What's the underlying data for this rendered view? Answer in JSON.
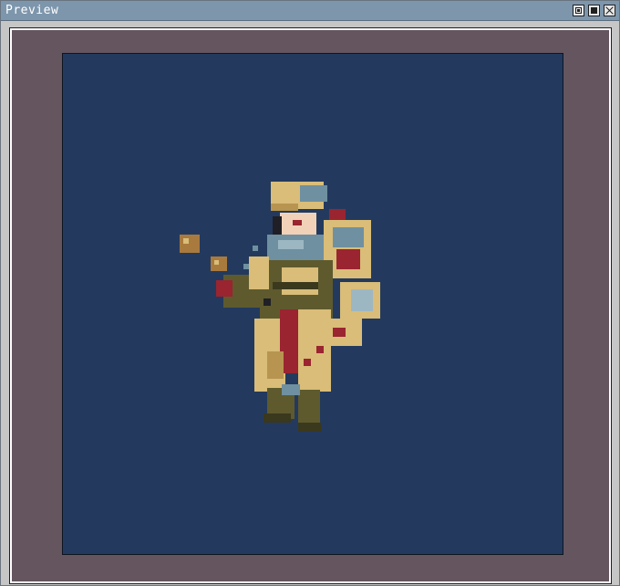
{
  "window": {
    "title": "Preview"
  },
  "titlebar_buttons": {
    "pin_icon": "pin-icon",
    "maximize_icon": "maximize-icon",
    "close_icon": "close-icon"
  },
  "colors": {
    "titlebar": "#7d96ac",
    "frame_bg": "#64555f",
    "canvas_bg": "#233a5e",
    "sprite_gold": "#d9bd78",
    "sprite_steel": "#6f90a0",
    "sprite_olive": "#5e5a2e",
    "sprite_red": "#9a2430",
    "sprite_brown": "#a97a3e"
  }
}
